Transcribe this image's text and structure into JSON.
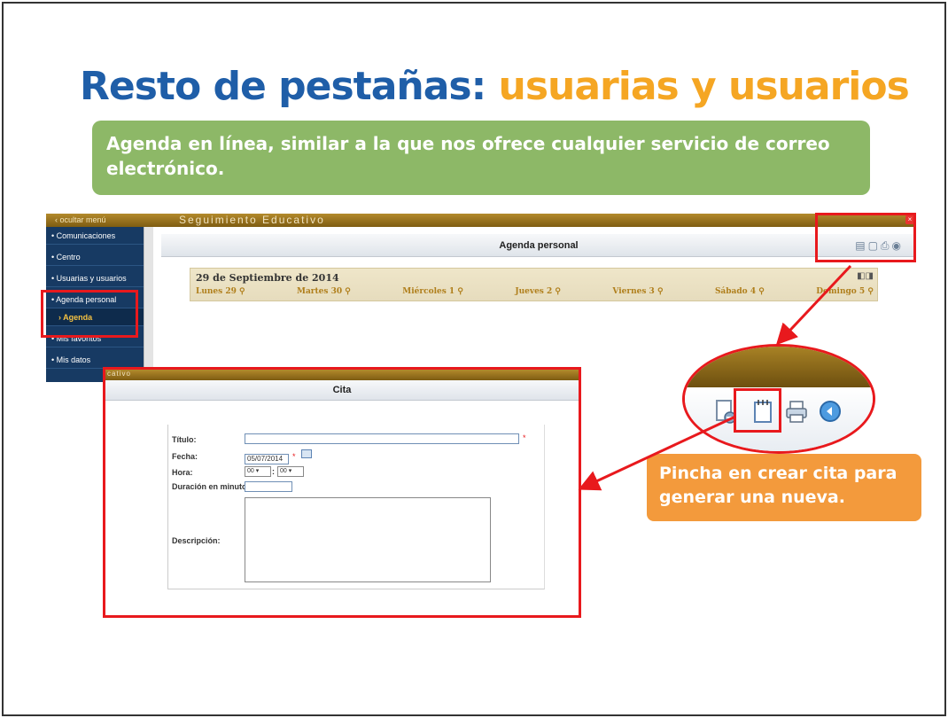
{
  "slide": {
    "title_part1": "Resto de pestañas:",
    "title_part2": "usuarias y usuarios",
    "intro": "Agenda en línea, similar a la que nos ofrece cualquier servicio de correo electrónico.",
    "callout": "Pincha en crear cita para generar una nueva."
  },
  "app": {
    "hide_menu": "‹ ocultar menú",
    "brand": "Seguimiento Educativo",
    "sidebar": [
      {
        "label": "• Comunicaciones"
      },
      {
        "label": "• Centro"
      },
      {
        "label": "• Usuarias y usuarios"
      },
      {
        "label": "• Agenda personal"
      },
      {
        "label": "› Agenda"
      },
      {
        "label": "• Mis favoritos"
      },
      {
        "label": "• Mis datos"
      }
    ],
    "page_title": "Agenda personal",
    "calendar": {
      "date": "29 de Septiembre de 2014",
      "days": [
        "Lunes 29",
        "Martes 30",
        "Miércoles 1",
        "Jueves 2",
        "Viernes 3",
        "Sábado 4",
        "Domingo 5"
      ]
    }
  },
  "cita": {
    "bar_text": "cativo",
    "title": "Cita",
    "labels": {
      "titulo": "Título:",
      "fecha": "Fecha:",
      "hora": "Hora:",
      "duracion": "Duración en minutos:",
      "descripcion": "Descripción:"
    },
    "fecha_value": "05/07/2014",
    "hour_value": "00",
    "minute_value": "00",
    "hour_sep": ":",
    "required_mark": "*"
  },
  "colors": {
    "title_blue": "#1f5ea8",
    "title_orange": "#f5a623",
    "green": "#8db867",
    "orange_callout": "#f39a3c",
    "highlight_red": "#e8191d",
    "sidebar_navy": "#173a63"
  }
}
